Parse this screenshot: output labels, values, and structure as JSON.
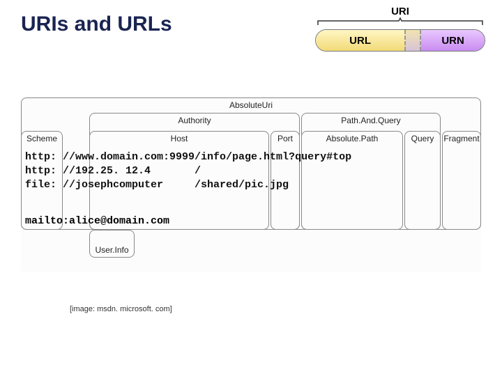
{
  "title": "URIs and URLs",
  "uri_small": {
    "top": "URI",
    "left": "URL",
    "right": "URN"
  },
  "boxes": {
    "absuri": "AbsoluteUri",
    "authority": "Authority",
    "pathq": "Path.And.Query",
    "scheme": "Scheme",
    "host": "Host",
    "port": "Port",
    "abspath": "Absolute.Path",
    "query": "Query",
    "fragment": "Fragment",
    "userinfo": "User.Info"
  },
  "rows": {
    "r1": "http: //www.domain.com:9999/info/page.html?query#top",
    "r2": "http: //192.25. 12.4       /",
    "r3": "file: //josephcomputer     /shared/pic.jpg",
    "r4": "mailto:alice@domain.com"
  },
  "caption": "[image: msdn. microsoft. com]"
}
